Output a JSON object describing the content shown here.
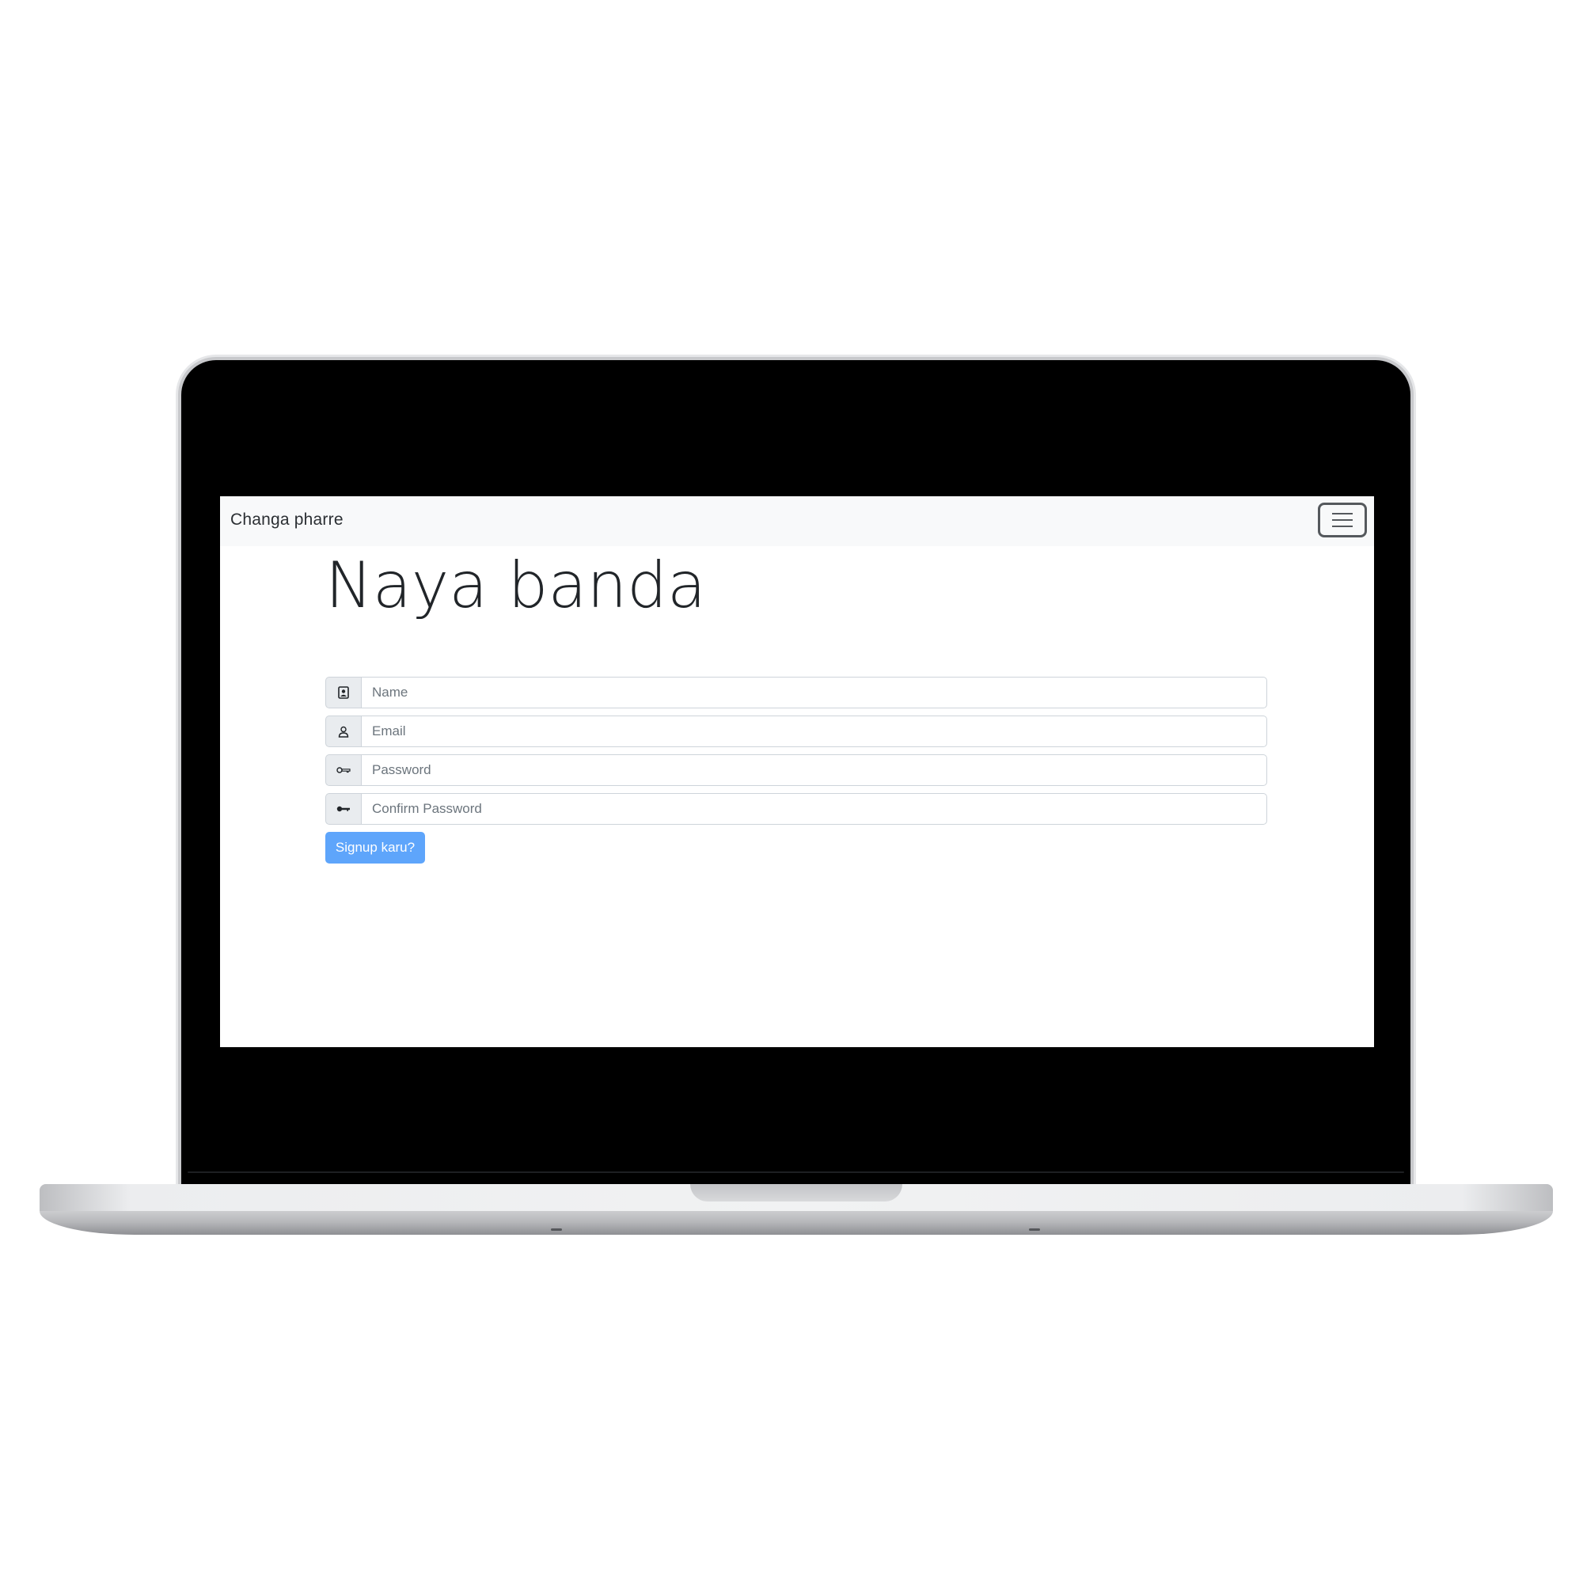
{
  "navbar": {
    "brand": "Changa pharre",
    "toggler_icon": "hamburger-icon"
  },
  "form": {
    "title": "Naya banda",
    "fields": [
      {
        "icon": "contact-card-icon",
        "placeholder": "Name",
        "value": ""
      },
      {
        "icon": "person-icon",
        "placeholder": "Email",
        "value": ""
      },
      {
        "icon": "key-outline-icon",
        "placeholder": "Password",
        "value": ""
      },
      {
        "icon": "key-filled-icon",
        "placeholder": "Confirm Password",
        "value": ""
      }
    ],
    "submit_label": "Signup karu?"
  },
  "colors": {
    "navbar_bg": "#f8f9fa",
    "primary_button": "#5ea5fb",
    "addon_bg": "#e9ecef",
    "border": "#ced4da"
  }
}
